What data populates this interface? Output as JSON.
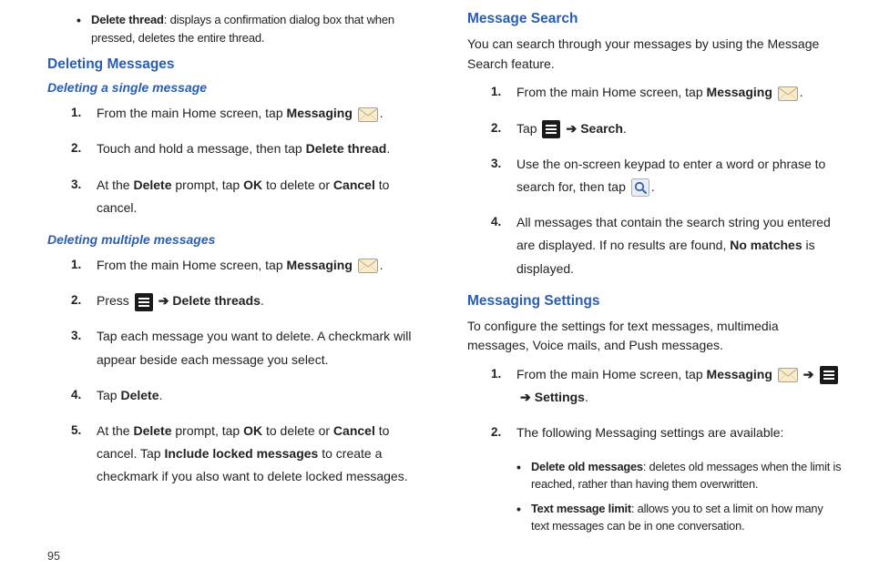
{
  "col1": {
    "bullet1": {
      "label": "Delete thread",
      "text": ": displays a confirmation dialog box that when pressed, deletes the entire thread."
    },
    "h1": "Deleting Messages",
    "sub1": "Deleting a single message",
    "s1": {
      "n1": "1.",
      "t1a": "From the main Home screen, tap ",
      "t1b": "Messaging",
      "t1c": ".",
      "n2": "2.",
      "t2a": "Touch and hold a message, then tap ",
      "t2b": "Delete thread",
      "t2c": ".",
      "n3": "3.",
      "t3a": "At the ",
      "t3b": "Delete",
      "t3c": " prompt, tap ",
      "t3d": "OK",
      "t3e": " to delete or ",
      "t3f": "Cancel",
      "t3g": " to cancel."
    },
    "sub2": "Deleting multiple messages",
    "s2": {
      "n1": "1.",
      "t1a": "From the main Home screen, tap ",
      "t1b": "Messaging",
      "t1c": ".",
      "n2": "2.",
      "t2a": "Press ",
      "t2b": "Delete threads",
      "t2c": ".",
      "n3": "3.",
      "t3": "Tap each message you want to delete. A checkmark will appear beside each message you select.",
      "n4": "4.",
      "t4a": "Tap ",
      "t4b": "Delete",
      "t4c": ".",
      "n5": "5.",
      "t5a": "At the ",
      "t5b": "Delete",
      "t5c": " prompt, tap ",
      "t5d": "OK",
      "t5e": " to delete or ",
      "t5f": "Cancel",
      "t5g": " to cancel. Tap ",
      "t5h": "Include locked messages",
      "t5i": " to create a checkmark if you also want to delete locked messages."
    }
  },
  "col2": {
    "h1": "Message Search",
    "p1": "You can search through your messages by using the Message Search feature.",
    "s1": {
      "n1": "1.",
      "t1a": "From the main Home screen, tap ",
      "t1b": "Messaging",
      "t1c": ".",
      "n2": "2.",
      "t2a": "Tap ",
      "t2b": "Search",
      "t2c": ".",
      "n3": "3.",
      "t3a": "Use the on-screen keypad to enter a word or phrase to search for, then tap ",
      "t3b": ".",
      "n4": "4.",
      "t4a": "All messages that contain the search string you entered are displayed. If no results are found, ",
      "t4b": "No matches",
      "t4c": " is displayed."
    },
    "h2": "Messaging Settings",
    "p2": "To configure the settings for text messages, multimedia messages, Voice mails, and Push messages.",
    "s2": {
      "n1": "1.",
      "t1a": "From the main Home screen, tap ",
      "t1b": "Messaging",
      "t1c": "Settings",
      "t1d": ".",
      "n2": "2.",
      "t2": "The following Messaging settings are available:",
      "b1l": "Delete old messages",
      "b1t": ": deletes old messages when the limit is reached, rather than having them overwritten.",
      "b2l": "Text message limit",
      "b2t": ": allows you to set a limit on how many text messages can be in one conversation."
    }
  },
  "arrow": "➔",
  "pagenum": "95"
}
